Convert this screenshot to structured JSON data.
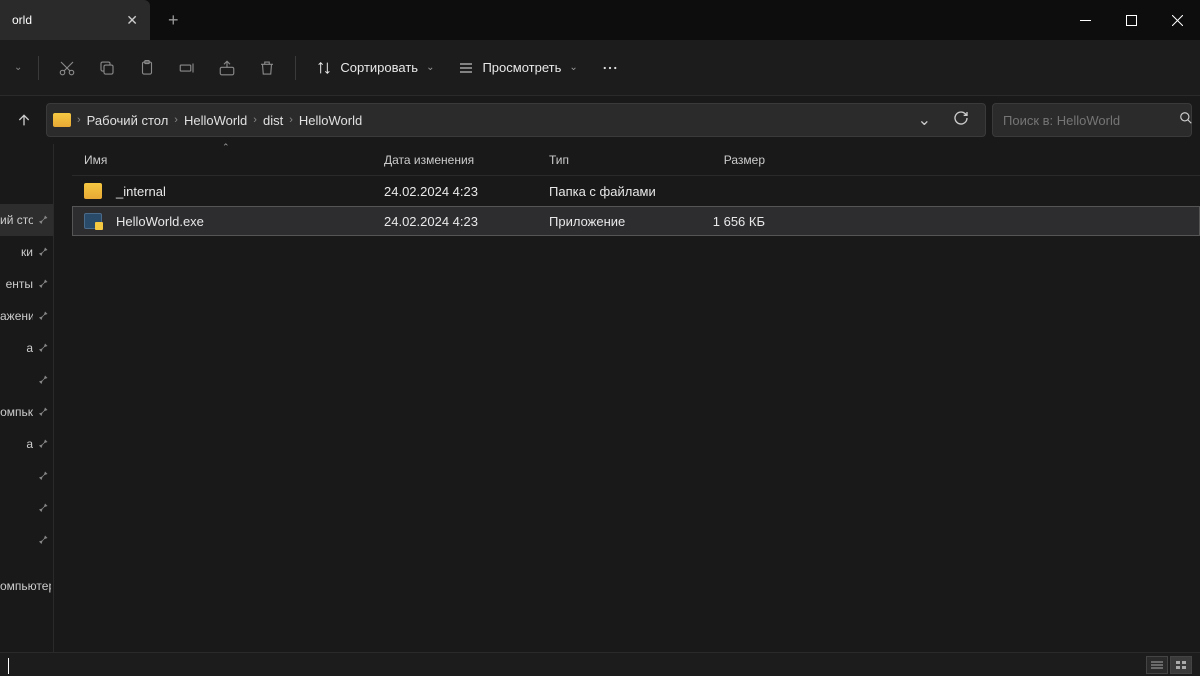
{
  "tab": {
    "title": "orld"
  },
  "toolbar": {
    "sort_label": "Сортировать",
    "view_label": "Просмотреть"
  },
  "breadcrumbs": [
    "Рабочий стол",
    "HelloWorld",
    "dist",
    "HelloWorld"
  ],
  "search": {
    "placeholder": "Поиск в: HelloWorld"
  },
  "columns": {
    "name": "Имя",
    "date": "Дата изменения",
    "type": "Тип",
    "size": "Размер"
  },
  "sidebar_items": [
    "",
    "ий сто.",
    "ки",
    "енты",
    "ажени",
    "а",
    "",
    "омпьк",
    "а",
    "",
    "",
    "",
    "омпьютер"
  ],
  "files": [
    {
      "name": "_internal",
      "date": "24.02.2024 4:23",
      "type": "Папка с файлами",
      "size": "",
      "icon": "folder"
    },
    {
      "name": "HelloWorld.exe",
      "date": "24.02.2024 4:23",
      "type": "Приложение",
      "size": "1 656 КБ",
      "icon": "exe"
    }
  ],
  "status": ""
}
